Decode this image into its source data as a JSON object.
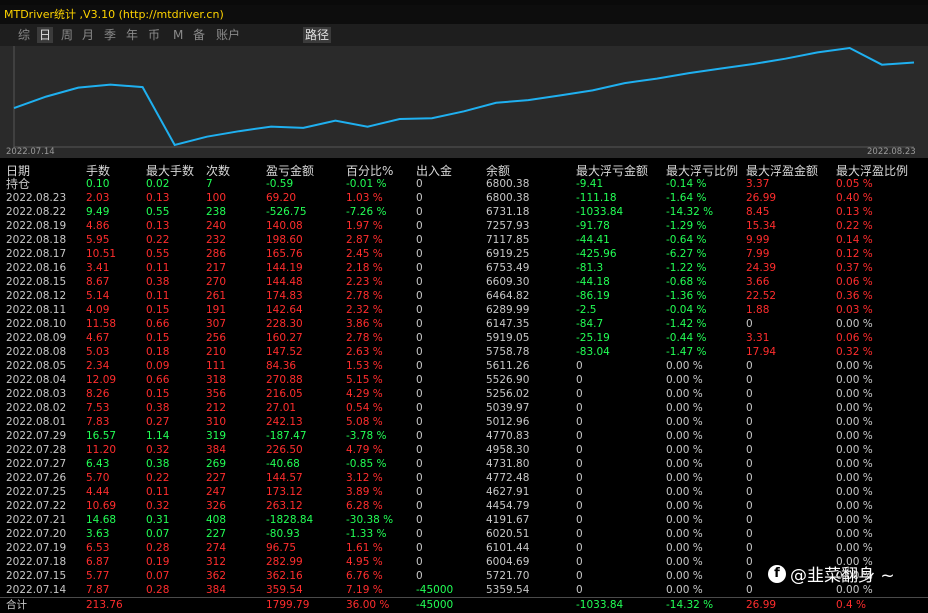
{
  "window": {
    "title": "MTDriver统计 ,V3.10 (http://mtdriver.cn)"
  },
  "tabs": [
    {
      "label": "综",
      "active": false
    },
    {
      "label": "日",
      "active": true
    },
    {
      "label": "周",
      "active": false
    },
    {
      "label": "月",
      "active": false
    },
    {
      "label": "季",
      "active": false
    },
    {
      "label": "年",
      "active": false
    },
    {
      "label": "币",
      "active": false
    },
    {
      "label": "M",
      "active": false
    },
    {
      "label": "备",
      "active": false
    },
    {
      "label": "账户",
      "active": false
    },
    {
      "label": "路径",
      "active": true
    }
  ],
  "colors": {
    "green": "#22ff55",
    "red": "#ff2d2d",
    "neutral": "#c8c8c8",
    "yellow": "#ffd400",
    "line": "#1fb0f0"
  },
  "chart_data": {
    "type": "line",
    "x_start_label": "2022.07.14",
    "x_end_label": "2022.08.23",
    "series": [
      {
        "values": [
          5359.54,
          5721.7,
          6004.69,
          6101.44,
          6020.51,
          4191.67,
          4454.79,
          4627.91,
          4772.48,
          4731.8,
          4958.3,
          4770.83,
          5012.96,
          5039.97,
          5256.02,
          5526.9,
          5611.26,
          5758.78,
          5919.05,
          6147.35,
          6289.99,
          6464.82,
          6609.3,
          6753.49,
          6919.25,
          7117.85,
          7257.93,
          6731.18,
          6800.38
        ]
      }
    ]
  },
  "table": {
    "headers": [
      "日期",
      "手数",
      "最大手数",
      "次数",
      "盈亏金额",
      "百分比%",
      "出入金",
      "余额",
      "最大浮亏金额",
      "最大浮亏比例",
      "最大浮盈金额",
      "最大浮盈比例"
    ],
    "rows": [
      [
        "持仓",
        "0.10",
        "0.02",
        "7",
        "-0.59",
        "-0.01 %",
        "0",
        "6800.38",
        "-9.41",
        "-0.14 %",
        "3.37",
        "0.05 %",
        "g",
        "n",
        "g",
        "r"
      ],
      [
        "2022.08.23",
        "2.03",
        "0.13",
        "100",
        "69.20",
        "1.03 %",
        "0",
        "6800.38",
        "-111.18",
        "-1.64 %",
        "26.99",
        "0.40 %",
        "r",
        "n",
        "g",
        "r"
      ],
      [
        "2022.08.22",
        "9.49",
        "0.55",
        "238",
        "-526.75",
        "-7.26 %",
        "0",
        "6731.18",
        "-1033.84",
        "-14.32 %",
        "8.45",
        "0.13 %",
        "g",
        "n",
        "g",
        "r"
      ],
      [
        "2022.08.19",
        "4.86",
        "0.13",
        "240",
        "140.08",
        "1.97 %",
        "0",
        "7257.93",
        "-91.78",
        "-1.29 %",
        "15.34",
        "0.22 %",
        "r",
        "n",
        "g",
        "r"
      ],
      [
        "2022.08.18",
        "5.95",
        "0.22",
        "232",
        "198.60",
        "2.87 %",
        "0",
        "7117.85",
        "-44.41",
        "-0.64 %",
        "9.99",
        "0.14 %",
        "r",
        "n",
        "g",
        "r"
      ],
      [
        "2022.08.17",
        "10.51",
        "0.55",
        "286",
        "165.76",
        "2.45 %",
        "0",
        "6919.25",
        "-425.96",
        "-6.27 %",
        "7.99",
        "0.12 %",
        "r",
        "n",
        "g",
        "r"
      ],
      [
        "2022.08.16",
        "3.41",
        "0.11",
        "217",
        "144.19",
        "2.18 %",
        "0",
        "6753.49",
        "-81.3",
        "-1.22 %",
        "24.39",
        "0.37 %",
        "r",
        "n",
        "g",
        "r"
      ],
      [
        "2022.08.15",
        "8.67",
        "0.38",
        "270",
        "144.48",
        "2.23 %",
        "0",
        "6609.30",
        "-44.18",
        "-0.68 %",
        "3.66",
        "0.06 %",
        "r",
        "n",
        "g",
        "r"
      ],
      [
        "2022.08.12",
        "5.14",
        "0.11",
        "261",
        "174.83",
        "2.78 %",
        "0",
        "6464.82",
        "-86.19",
        "-1.36 %",
        "22.52",
        "0.36 %",
        "r",
        "n",
        "g",
        "r"
      ],
      [
        "2022.08.11",
        "4.09",
        "0.15",
        "191",
        "142.64",
        "2.32 %",
        "0",
        "6289.99",
        "-2.5",
        "-0.04 %",
        "1.88",
        "0.03 %",
        "r",
        "n",
        "g",
        "r"
      ],
      [
        "2022.08.10",
        "11.58",
        "0.66",
        "307",
        "228.30",
        "3.86 %",
        "0",
        "6147.35",
        "-84.7",
        "-1.42 %",
        "0",
        "0.00 %",
        "r",
        "n",
        "g",
        "n"
      ],
      [
        "2022.08.09",
        "4.67",
        "0.15",
        "256",
        "160.27",
        "2.78 %",
        "0",
        "5919.05",
        "-25.19",
        "-0.44 %",
        "3.31",
        "0.06 %",
        "r",
        "n",
        "g",
        "r"
      ],
      [
        "2022.08.08",
        "5.03",
        "0.18",
        "210",
        "147.52",
        "2.63 %",
        "0",
        "5758.78",
        "-83.04",
        "-1.47 %",
        "17.94",
        "0.32 %",
        "r",
        "n",
        "g",
        "r"
      ],
      [
        "2022.08.05",
        "2.34",
        "0.09",
        "111",
        "84.36",
        "1.53 %",
        "0",
        "5611.26",
        "0",
        "0.00 %",
        "0",
        "0.00 %",
        "r",
        "n",
        "n",
        "n"
      ],
      [
        "2022.08.04",
        "12.09",
        "0.66",
        "318",
        "270.88",
        "5.15 %",
        "0",
        "5526.90",
        "0",
        "0.00 %",
        "0",
        "0.00 %",
        "r",
        "n",
        "n",
        "n"
      ],
      [
        "2022.08.03",
        "8.26",
        "0.15",
        "356",
        "216.05",
        "4.29 %",
        "0",
        "5256.02",
        "0",
        "0.00 %",
        "0",
        "0.00 %",
        "r",
        "n",
        "n",
        "n"
      ],
      [
        "2022.08.02",
        "7.53",
        "0.38",
        "212",
        "27.01",
        "0.54 %",
        "0",
        "5039.97",
        "0",
        "0.00 %",
        "0",
        "0.00 %",
        "r",
        "n",
        "n",
        "n"
      ],
      [
        "2022.08.01",
        "7.83",
        "0.27",
        "310",
        "242.13",
        "5.08 %",
        "0",
        "5012.96",
        "0",
        "0.00 %",
        "0",
        "0.00 %",
        "r",
        "n",
        "n",
        "n"
      ],
      [
        "2022.07.29",
        "16.57",
        "1.14",
        "319",
        "-187.47",
        "-3.78 %",
        "0",
        "4770.83",
        "0",
        "0.00 %",
        "0",
        "0.00 %",
        "g",
        "n",
        "n",
        "n"
      ],
      [
        "2022.07.28",
        "11.20",
        "0.32",
        "384",
        "226.50",
        "4.79 %",
        "0",
        "4958.30",
        "0",
        "0.00 %",
        "0",
        "0.00 %",
        "r",
        "n",
        "n",
        "n"
      ],
      [
        "2022.07.27",
        "6.43",
        "0.38",
        "269",
        "-40.68",
        "-0.85 %",
        "0",
        "4731.80",
        "0",
        "0.00 %",
        "0",
        "0.00 %",
        "g",
        "n",
        "n",
        "n"
      ],
      [
        "2022.07.26",
        "5.70",
        "0.22",
        "227",
        "144.57",
        "3.12 %",
        "0",
        "4772.48",
        "0",
        "0.00 %",
        "0",
        "0.00 %",
        "r",
        "n",
        "n",
        "n"
      ],
      [
        "2022.07.25",
        "4.44",
        "0.11",
        "247",
        "173.12",
        "3.89 %",
        "0",
        "4627.91",
        "0",
        "0.00 %",
        "0",
        "0.00 %",
        "r",
        "n",
        "n",
        "n"
      ],
      [
        "2022.07.22",
        "10.69",
        "0.32",
        "326",
        "263.12",
        "6.28 %",
        "0",
        "4454.79",
        "0",
        "0.00 %",
        "0",
        "0.00 %",
        "r",
        "n",
        "n",
        "n"
      ],
      [
        "2022.07.21",
        "14.68",
        "0.31",
        "408",
        "-1828.84",
        "-30.38 %",
        "0",
        "4191.67",
        "0",
        "0.00 %",
        "0",
        "0.00 %",
        "g",
        "n",
        "n",
        "n"
      ],
      [
        "2022.07.20",
        "3.63",
        "0.07",
        "227",
        "-80.93",
        "-1.33 %",
        "0",
        "6020.51",
        "0",
        "0.00 %",
        "0",
        "0.00 %",
        "g",
        "n",
        "n",
        "n"
      ],
      [
        "2022.07.19",
        "6.53",
        "0.28",
        "274",
        "96.75",
        "1.61 %",
        "0",
        "6101.44",
        "0",
        "0.00 %",
        "0",
        "0.00 %",
        "r",
        "n",
        "n",
        "n"
      ],
      [
        "2022.07.18",
        "6.87",
        "0.19",
        "312",
        "282.99",
        "4.95 %",
        "0",
        "6004.69",
        "0",
        "0.00 %",
        "0",
        "0.00 %",
        "r",
        "n",
        "n",
        "n"
      ],
      [
        "2022.07.15",
        "5.77",
        "0.07",
        "362",
        "362.16",
        "6.76 %",
        "0",
        "5721.70",
        "0",
        "0.00 %",
        "0",
        "0.00 %",
        "r",
        "n",
        "n",
        "n"
      ],
      [
        "2022.07.14",
        "7.87",
        "0.28",
        "384",
        "359.54",
        "7.19 %",
        "-45000",
        "5359.54",
        "0",
        "0.00 %",
        "0",
        "0.00 %",
        "r",
        "g",
        "n",
        "n"
      ]
    ],
    "total": [
      "合计",
      "213.76",
      "",
      "",
      "1799.79",
      "36.00 %",
      "-45000",
      "",
      "-1033.84",
      "-14.32 %",
      "26.99",
      "0.4 %"
    ]
  },
  "watermark": {
    "icon": "facebook-icon",
    "text": "@韭菜翻身 ~"
  }
}
